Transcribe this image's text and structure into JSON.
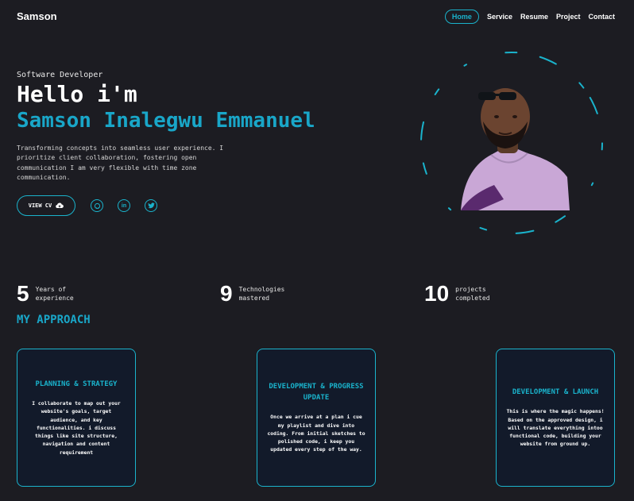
{
  "nav": {
    "logo": "Samson",
    "items": [
      {
        "label": "Home",
        "active": true
      },
      {
        "label": "Service",
        "active": false
      },
      {
        "label": "Resume",
        "active": false
      },
      {
        "label": "Project",
        "active": false
      },
      {
        "label": "Contact",
        "active": false
      }
    ]
  },
  "hero": {
    "subtitle": "Software Developer",
    "greeting": "Hello i'm",
    "name": "Samson Inalegwu Emmanuel",
    "description": "Transforming concepts into seamless user experience. I prioritize client collaboration, fostering open communication I am very flexible with time zone communication.",
    "cv_button": "VIEW CV",
    "cv_icon": "cloud-download-icon",
    "socials": [
      {
        "name": "github-icon",
        "glyph": "◯"
      },
      {
        "name": "linkedin-icon",
        "glyph": "in"
      },
      {
        "name": "twitter-icon",
        "glyph": "🐦"
      }
    ]
  },
  "stats": [
    {
      "value": "5",
      "label": "Years of experience"
    },
    {
      "value": "9",
      "label": "Technologies mastered"
    },
    {
      "value": "10",
      "label": "projects completed"
    }
  ],
  "approach": {
    "heading": "MY APPROACH",
    "cards": [
      {
        "title": "PLANNING & STRATEGY",
        "body": "I collaborate to map out your website's goals, target audience, and key functionalities. i discuss things like site structure, navigation and content requirement"
      },
      {
        "title": "DEVELOPMENT & PROGRESS UPDATE",
        "body": "Once we arrive at a plan i cue my playlist and dive into coding. From initial sketches to polished code, i keep you updated every step of the way."
      },
      {
        "title": "DEVELOPMENT & LAUNCH",
        "body": "This is where the magic happens! Based on the approved design, i will translate everything intoo functional code, building your website from ground up."
      }
    ]
  },
  "colors": {
    "accent": "#19a6c8",
    "background": "#1c1c22",
    "card": "#121a2a"
  }
}
